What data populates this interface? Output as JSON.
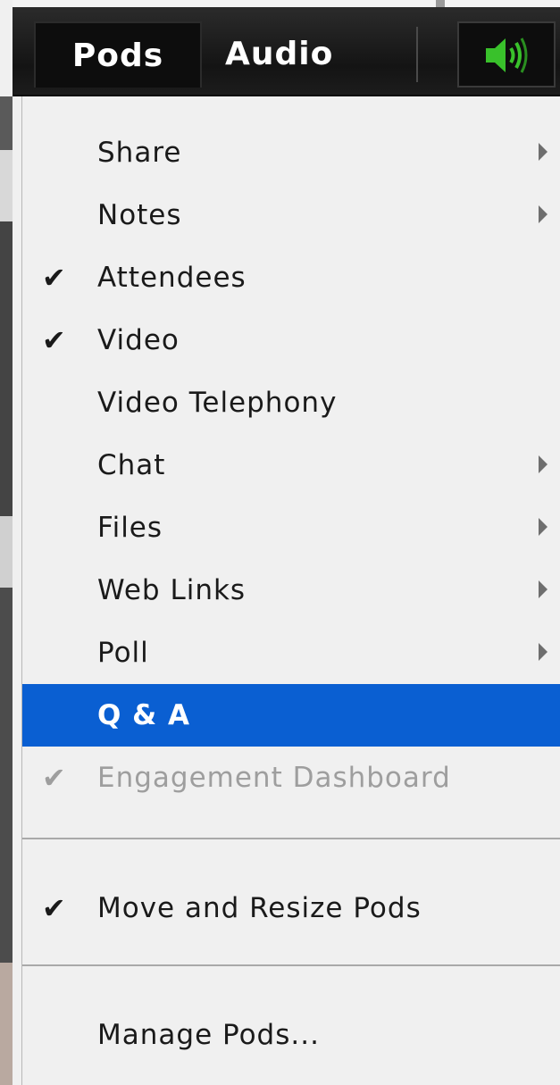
{
  "menubar": {
    "tabs": [
      {
        "label": "Pods",
        "active": true
      },
      {
        "label": "Audio",
        "active": false
      }
    ],
    "speaker_icon": "speaker-volume-icon",
    "speaker_color": "#39c12b"
  },
  "menu": {
    "items": [
      {
        "label": "Share",
        "checked": false,
        "submenu": true,
        "highlighted": false,
        "disabled": false
      },
      {
        "label": "Notes",
        "checked": false,
        "submenu": true,
        "highlighted": false,
        "disabled": false
      },
      {
        "label": "Attendees",
        "checked": true,
        "submenu": false,
        "highlighted": false,
        "disabled": false
      },
      {
        "label": "Video",
        "checked": true,
        "submenu": false,
        "highlighted": false,
        "disabled": false
      },
      {
        "label": "Video Telephony",
        "checked": false,
        "submenu": false,
        "highlighted": false,
        "disabled": false
      },
      {
        "label": "Chat",
        "checked": false,
        "submenu": true,
        "highlighted": false,
        "disabled": false
      },
      {
        "label": "Files",
        "checked": false,
        "submenu": true,
        "highlighted": false,
        "disabled": false
      },
      {
        "label": "Web Links",
        "checked": false,
        "submenu": true,
        "highlighted": false,
        "disabled": false
      },
      {
        "label": "Poll",
        "checked": false,
        "submenu": true,
        "highlighted": false,
        "disabled": false
      },
      {
        "label": "Q & A",
        "checked": false,
        "submenu": false,
        "highlighted": true,
        "disabled": false
      },
      {
        "label": "Engagement Dashboard",
        "checked": true,
        "submenu": false,
        "highlighted": false,
        "disabled": true
      }
    ],
    "layout_items": [
      {
        "label": "Move and Resize Pods",
        "checked": true,
        "submenu": false,
        "highlighted": false,
        "disabled": false
      }
    ],
    "manage_items": [
      {
        "label": "Manage Pods...",
        "checked": false,
        "submenu": false,
        "highlighted": false,
        "disabled": false
      }
    ],
    "check_glyph": "✔",
    "highlight_color": "#0a5fd2"
  }
}
